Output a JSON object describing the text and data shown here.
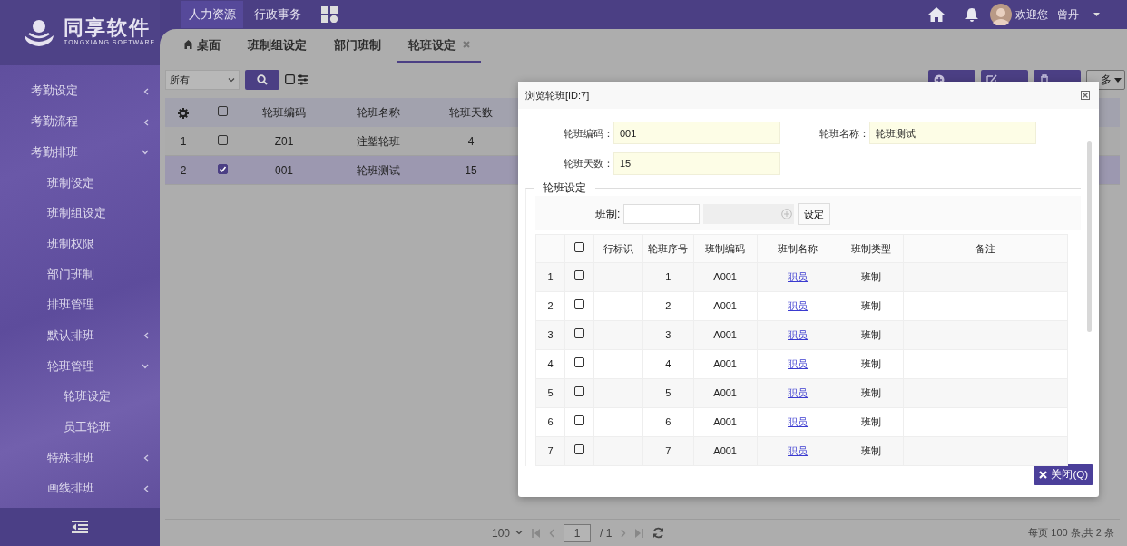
{
  "header": {
    "logo_title": "同享软件",
    "logo_subtitle": "TONGXIANG SOFTWARE",
    "nav": [
      {
        "label": "人力资源",
        "selected": true
      },
      {
        "label": "行政事务",
        "selected": false
      }
    ],
    "welcome": "欢迎您",
    "user": "曾丹"
  },
  "sidebar": {
    "items": [
      {
        "label": "考勤设定",
        "expanded": false
      },
      {
        "label": "考勤流程",
        "expanded": false
      },
      {
        "label": "考勤排班",
        "expanded": true,
        "children": [
          {
            "label": "班制设定"
          },
          {
            "label": "班制组设定"
          },
          {
            "label": "班制权限"
          },
          {
            "label": "部门班制"
          },
          {
            "label": "排班管理"
          },
          {
            "label": "默认排班",
            "expanded": false
          },
          {
            "label": "轮班管理",
            "expanded": true,
            "children": [
              {
                "label": "轮班设定"
              },
              {
                "label": "员工轮班"
              }
            ]
          },
          {
            "label": "特殊排班",
            "expanded": false
          },
          {
            "label": "画线排班",
            "expanded": false
          }
        ]
      }
    ]
  },
  "tabs": [
    {
      "kind": "home",
      "label": "桌面",
      "selected": false
    },
    {
      "kind": "page",
      "label": "班制组设定",
      "selected": false
    },
    {
      "kind": "page",
      "label": "部门班制",
      "selected": false
    },
    {
      "kind": "closable",
      "label": "轮班设定",
      "selected": true
    }
  ],
  "toolbar": {
    "filter": "所有",
    "actions": [
      {
        "kind": "add"
      },
      {
        "kind": "edit"
      },
      {
        "kind": "delete"
      },
      {
        "kind": "more",
        "label": "多"
      }
    ]
  },
  "grid": {
    "select_all": {
      "checked": false
    },
    "columns": [
      "轮班编码",
      "轮班名称",
      "轮班天数"
    ],
    "rows": [
      {
        "index": "1",
        "selected": false,
        "cells": [
          "Z01",
          "注塑轮班",
          "4"
        ]
      },
      {
        "index": "2",
        "selected": true,
        "cells": [
          "001",
          "轮班测试",
          "15"
        ]
      }
    ]
  },
  "pager": {
    "page_size": "100",
    "page": "1",
    "total_pages": "/ 1",
    "summary": "每页 100 条,共 2 条"
  },
  "modal": {
    "title": "浏览轮班[ID:7]",
    "fields": [
      {
        "label": "轮班编码：",
        "value": "001"
      },
      {
        "label": "轮班名称：",
        "value": "轮班测试"
      },
      {
        "label": "轮班天数：",
        "value": "15"
      }
    ],
    "section": "轮班设定",
    "shift_label": "班制:",
    "set_button": "设定",
    "select_all": {
      "checked": false
    },
    "columns": [
      "行标识",
      "轮班序号",
      "班制编码",
      "班制名称",
      "班制类型",
      "备注"
    ],
    "rows": [
      {
        "index": "1",
        "checked": false,
        "seq": "1",
        "code": "A001",
        "name": "职员",
        "type": "班制"
      },
      {
        "index": "2",
        "checked": false,
        "seq": "2",
        "code": "A001",
        "name": "职员",
        "type": "班制"
      },
      {
        "index": "3",
        "checked": false,
        "seq": "3",
        "code": "A001",
        "name": "职员",
        "type": "班制"
      },
      {
        "index": "4",
        "checked": false,
        "seq": "4",
        "code": "A001",
        "name": "职员",
        "type": "班制"
      },
      {
        "index": "5",
        "checked": false,
        "seq": "5",
        "code": "A001",
        "name": "职员",
        "type": "班制"
      },
      {
        "index": "6",
        "checked": false,
        "seq": "6",
        "code": "A001",
        "name": "职员",
        "type": "班制"
      },
      {
        "index": "7",
        "checked": false,
        "seq": "7",
        "code": "A001",
        "name": "职员",
        "type": "班制"
      }
    ],
    "close_button": "关闭(Q)"
  }
}
